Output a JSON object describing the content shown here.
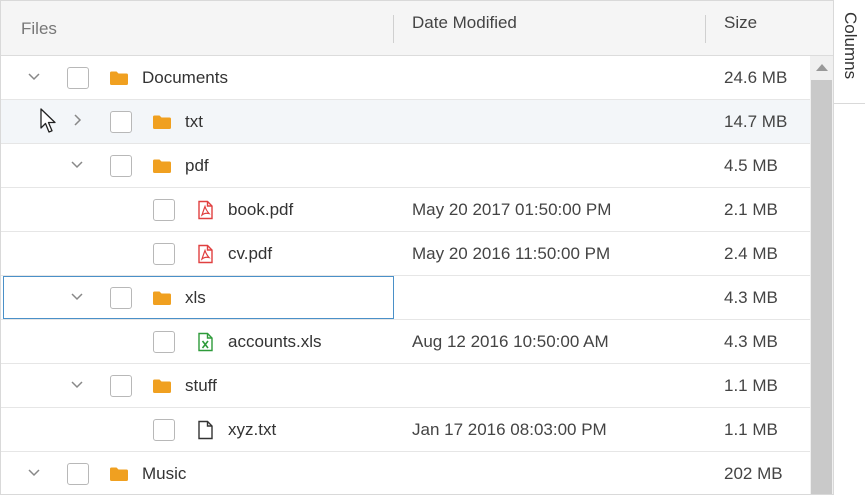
{
  "header": {
    "files_label": "Files",
    "date_label": "Date Modified",
    "size_label": "Size"
  },
  "side_panel": {
    "columns_label": "Columns"
  },
  "rows": [
    {
      "name": "Documents",
      "date": "",
      "size": "24.6 MB",
      "type": "folder",
      "level": 0,
      "expanded": true
    },
    {
      "name": "txt",
      "date": "",
      "size": "14.7 MB",
      "type": "folder",
      "level": 1,
      "expanded": false
    },
    {
      "name": "pdf",
      "date": "",
      "size": "4.5 MB",
      "type": "folder",
      "level": 1,
      "expanded": true
    },
    {
      "name": "book.pdf",
      "date": "May 20 2017 01:50:00 PM",
      "size": "2.1 MB",
      "type": "pdf",
      "level": 2
    },
    {
      "name": "cv.pdf",
      "date": "May 20 2016 11:50:00 PM",
      "size": "2.4 MB",
      "type": "pdf",
      "level": 2
    },
    {
      "name": "xls",
      "date": "",
      "size": "4.3 MB",
      "type": "folder",
      "level": 1,
      "expanded": true
    },
    {
      "name": "accounts.xls",
      "date": "Aug 12 2016 10:50:00 AM",
      "size": "4.3 MB",
      "type": "xls",
      "level": 2
    },
    {
      "name": "stuff",
      "date": "",
      "size": "1.1 MB",
      "type": "folder",
      "level": 1,
      "expanded": true
    },
    {
      "name": "xyz.txt",
      "date": "Jan 17 2016 08:03:00 PM",
      "size": "1.1 MB",
      "type": "file",
      "level": 2
    },
    {
      "name": "Music",
      "date": "",
      "size": "202 MB",
      "type": "folder",
      "level": 0,
      "expanded": true
    }
  ],
  "colors": {
    "folder": "#f0a020",
    "pdf": "#e04040",
    "xls": "#2e9b3a",
    "focus_border": "#4a90c8"
  }
}
